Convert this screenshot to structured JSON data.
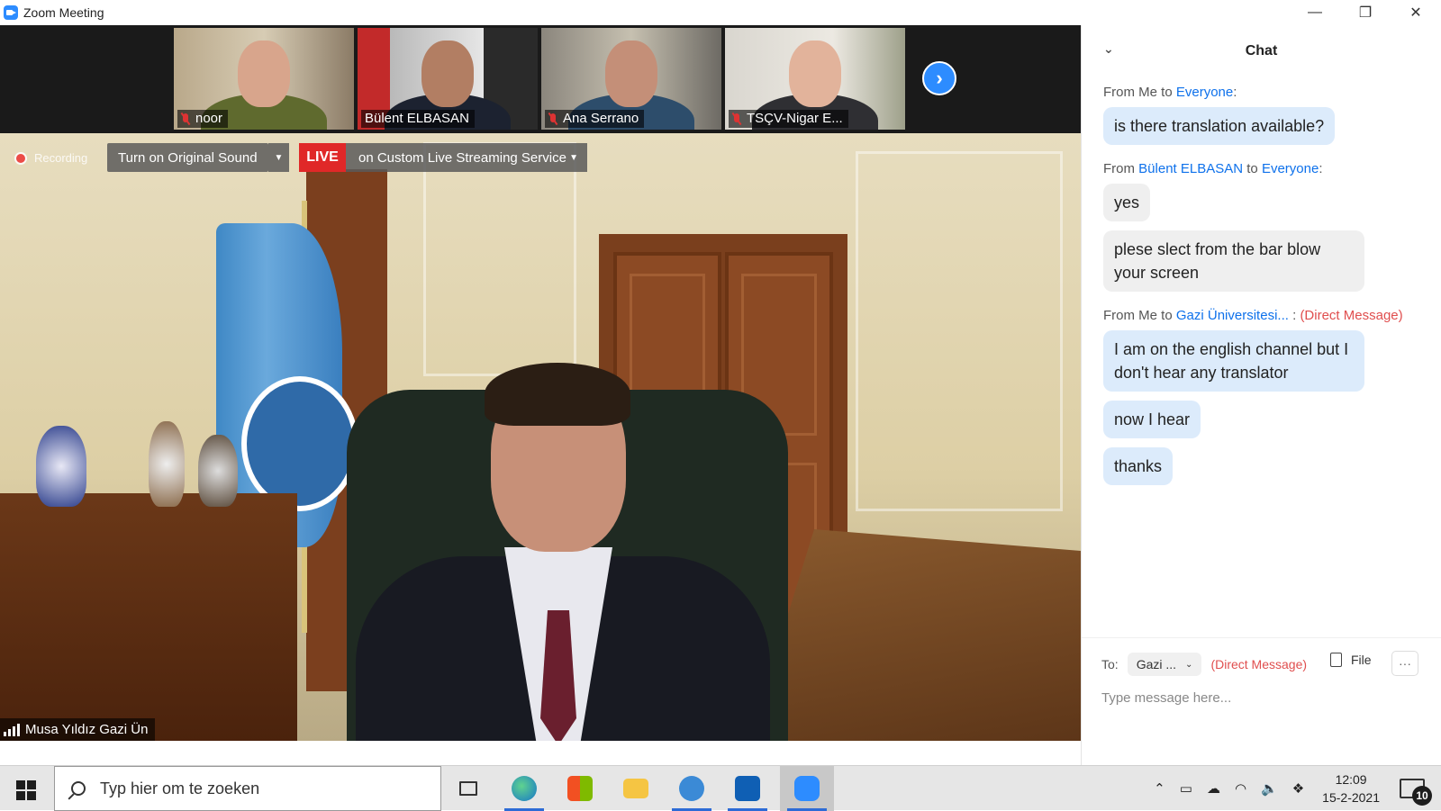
{
  "window": {
    "title": "Zoom Meeting",
    "controls": [
      "minimize-icon",
      "restore-icon",
      "close-icon"
    ]
  },
  "thumbnails": [
    {
      "name": "noor",
      "muted": true
    },
    {
      "name": "Bülent ELBASAN",
      "muted": false
    },
    {
      "name": "Ana Serrano",
      "muted": true
    },
    {
      "name": "TSÇV-Nigar E...",
      "muted": true
    }
  ],
  "recording": {
    "label": "Recording"
  },
  "original_sound": {
    "label": "Turn on Original Sound"
  },
  "live": {
    "badge": "LIVE",
    "label": "on Custom Live Streaming Service"
  },
  "speaker": {
    "name": "Musa Yıldız Gazi Ün"
  },
  "chat": {
    "title": "Chat",
    "groups": [
      {
        "from_prefix": "From ",
        "from": "Me",
        "to_prefix": " to ",
        "to": "Everyone",
        "suffix": ":",
        "dm": "",
        "side": "me",
        "messages": [
          "is there translation available?"
        ]
      },
      {
        "from_prefix": "From ",
        "from": "Bülent ELBASAN",
        "to_prefix": " to ",
        "to": "Everyone",
        "suffix": ":",
        "dm": "",
        "side": "other",
        "messages": [
          "yes",
          "plese slect from the bar blow your screen"
        ]
      },
      {
        "from_prefix": "From ",
        "from": "Me",
        "to_prefix": " to ",
        "to": "Gazi Üniversitesi...",
        "suffix": " : ",
        "dm": "(Direct Message)",
        "side": "me",
        "messages": [
          "I am on the english channel but I don't hear any translator",
          "now I hear",
          "thanks"
        ]
      }
    ],
    "composer": {
      "to_label": "To:",
      "recipient": "Gazi ...",
      "dm_label": "(Direct Message)",
      "file_label": "File",
      "more_label": "···",
      "placeholder": "Type message here..."
    }
  },
  "taskbar": {
    "search_placeholder": "Typ hier om te zoeken",
    "apps": [
      "task-view-icon",
      "edge-icon",
      "store-icon",
      "file-explorer-icon",
      "mail-icon",
      "outlook-icon",
      "zoom-icon"
    ],
    "time": "12:09",
    "date": "15-2-2021",
    "notifications": "10",
    "colors": {
      "accent": "#2d8cff",
      "live": "#e02828",
      "chat_me": "#dcebfb",
      "link": "#0e71eb",
      "dm": "#e04e4e"
    }
  }
}
